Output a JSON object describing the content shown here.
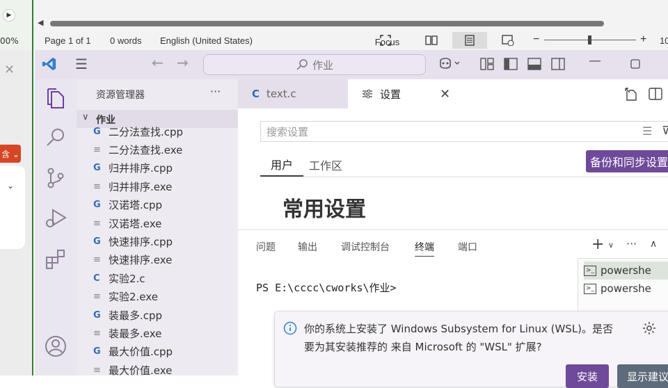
{
  "word": {
    "page_info": "Page 1 of 1",
    "word_count": "0 words",
    "language": "English (United States)",
    "focus_label": "Focus",
    "zoom_minus": "−",
    "zoom_plus": "+",
    "zoom_cut": "10",
    "left_pct": "00%"
  },
  "left_app": {
    "close": "✕",
    "red_button": "含 ⌄",
    "chevron": "⌄"
  },
  "titlebar": {
    "search_text": "作业"
  },
  "explorer": {
    "title": "资源管理器",
    "more": "···",
    "folder": "作业",
    "files": [
      {
        "name": "二分法查找.cpp",
        "type": "cpp"
      },
      {
        "name": "二分法查找.exe",
        "type": "exe"
      },
      {
        "name": "归并排序.cpp",
        "type": "cpp"
      },
      {
        "name": "归并排序.exe",
        "type": "exe"
      },
      {
        "name": "汉诺塔.cpp",
        "type": "cpp"
      },
      {
        "name": "汉诺塔.exe",
        "type": "exe"
      },
      {
        "name": "快速排序.cpp",
        "type": "cpp"
      },
      {
        "name": "快速排序.exe",
        "type": "exe"
      },
      {
        "name": "实验2.c",
        "type": "c"
      },
      {
        "name": "实验2.exe",
        "type": "exe"
      },
      {
        "name": "装最多.cpp",
        "type": "cpp"
      },
      {
        "name": "装最多.exe",
        "type": "exe"
      },
      {
        "name": "最大价值.cpp",
        "type": "cpp"
      },
      {
        "name": "最大价值.exe",
        "type": "exe"
      }
    ]
  },
  "tabs": [
    {
      "icon": "C",
      "label": "text.c"
    },
    {
      "icon": "⚙",
      "label": "设置"
    }
  ],
  "settings": {
    "search_placeholder": "搜索设置",
    "scope_tabs": [
      "用户",
      "工作区"
    ],
    "sync_button": "备份和同步设置",
    "heading": "常用设置"
  },
  "panel": {
    "tabs": [
      "问题",
      "输出",
      "调试控制台",
      "终端",
      "端口"
    ],
    "active_tab": "终端",
    "prompt": "PS E:\\cccc\\cworks\\作业>",
    "terminals": [
      "powershe",
      "powershe"
    ]
  },
  "notification": {
    "message_line1": "你的系统上安装了 Windows Subsystem for Linux (WSL)。是否",
    "message_line2": "要为其安装推荐的 来自 Microsoft 的 \"WSL\" 扩展?",
    "install_button": "安装",
    "show_button": "显示建议"
  },
  "colors": {
    "accent": "#6b3fa0",
    "sync_bg": "#6f4a9a",
    "terminal_selected": "#dde4dc",
    "word_border": "#2e7d32"
  }
}
